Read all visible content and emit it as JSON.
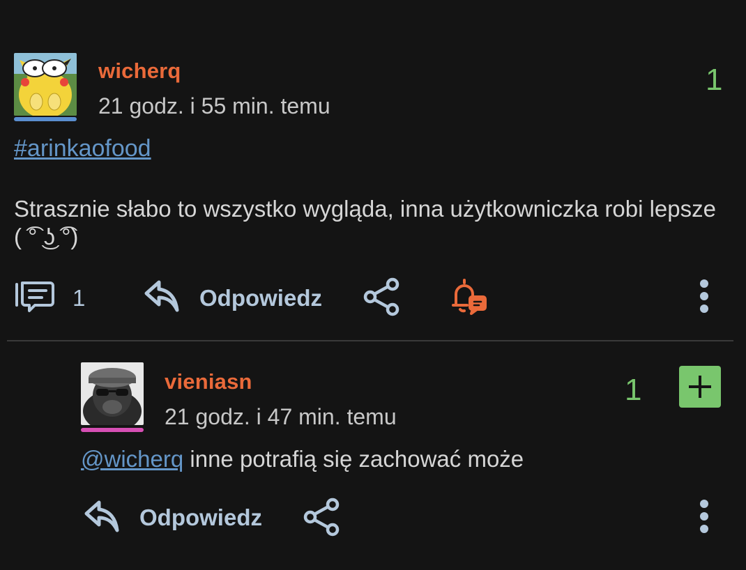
{
  "post": {
    "username": "wicherq",
    "time": "21 godz. i 55 min. temu",
    "score": "1",
    "tag": "#arinkaofood",
    "text": "Strasznie słabo to wszystko wygląda, inna użytkowniczka robi lepsze ( ͡° ͜ʖ ͡°)",
    "comment_count": "1",
    "reply_label": "Odpowiedz",
    "user_bar_color": "#5a8ed0"
  },
  "reply": {
    "username": "vieniasn",
    "time": "21 godz. i 47 min. temu",
    "score": "1",
    "mention": "@wicherq",
    "text": " inne potrafią się zachować może",
    "reply_label": "Odpowiedz",
    "user_bar_color": "#d64fb4"
  },
  "colors": {
    "accent": "#ea6a3a",
    "score": "#79c66d",
    "link": "#6496c8",
    "icon": "#b4c8dc"
  },
  "icons": {
    "comments": "comments-icon",
    "reply": "reply-arrow-icon",
    "share": "share-icon",
    "notify": "bell-notification-icon",
    "more": "more-vertical-icon",
    "plus": "plus-icon"
  }
}
